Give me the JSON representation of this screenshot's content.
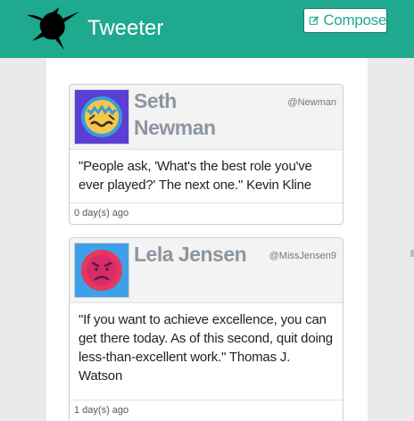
{
  "app": {
    "title": "Tweeter",
    "compose_label": "Compose",
    "brand_color": "#1fa98f"
  },
  "tweets": [
    {
      "name": "Seth Newman",
      "handle": "@Newman",
      "text": "\"People ask, 'What's the best role you've ever played?' The next one.\" Kevin Kline",
      "time": "0 day(s) ago",
      "avatar_icon": "crying-face-avatar"
    },
    {
      "name": "Lela Jensen",
      "handle": "@MissJensen9",
      "text": "\"If you want to achieve excellence, you can get there today. As of this second, quit doing less-than-excellent work.\" Thomas J. Watson",
      "time": "1 day(s) ago",
      "avatar_icon": "angry-face-avatar"
    }
  ]
}
